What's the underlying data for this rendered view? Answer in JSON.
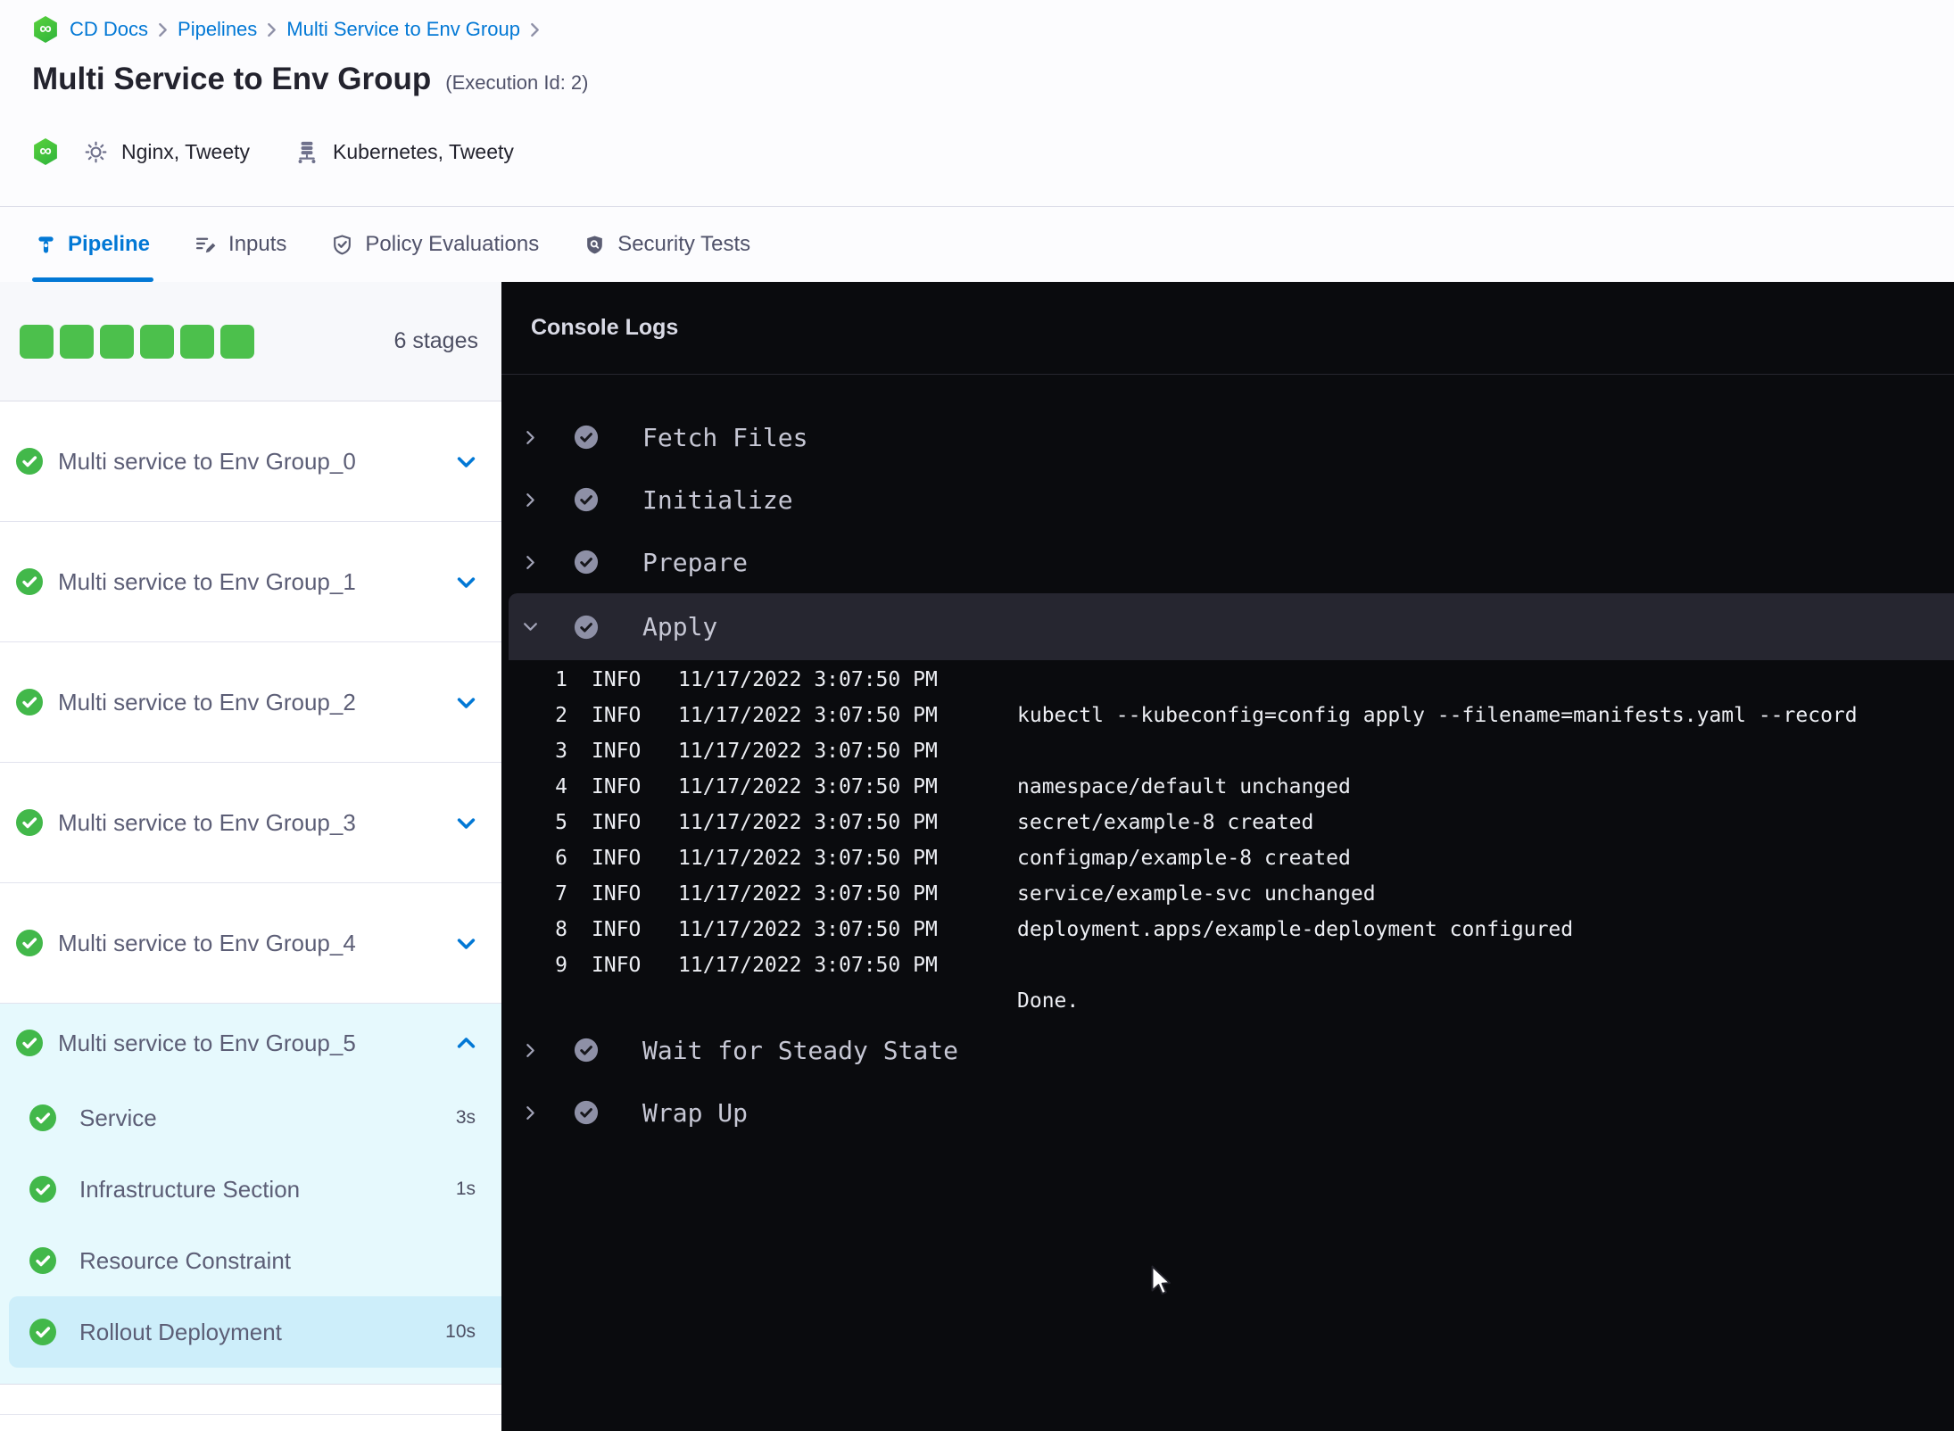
{
  "colors": {
    "accent_blue": "#0278d5",
    "success_green": "#42b84a",
    "progress_square_green": "#4cc04c",
    "console_bg": "#0a0b0e",
    "expanded_stage_bg": "#e6f9fd",
    "selected_step_bg": "#cdeefa"
  },
  "breadcrumb": {
    "items": [
      {
        "label": "CD Docs"
      },
      {
        "label": "Pipelines"
      },
      {
        "label": "Multi Service to Env Group"
      }
    ]
  },
  "header": {
    "title": "Multi Service to Env Group",
    "execution_id": "(Execution Id: 2)",
    "services_label": "Nginx, Tweety",
    "environments_label": "Kubernetes, Tweety"
  },
  "tabs": [
    {
      "label": "Pipeline"
    },
    {
      "label": "Inputs"
    },
    {
      "label": "Policy Evaluations"
    },
    {
      "label": "Security Tests"
    }
  ],
  "sidebar": {
    "progress_squares": 6,
    "stage_count_label": "6 stages",
    "stages": [
      {
        "label": "Multi service to Env Group_0"
      },
      {
        "label": "Multi service to Env Group_1"
      },
      {
        "label": "Multi service to Env Group_2"
      },
      {
        "label": "Multi service to Env Group_3"
      },
      {
        "label": "Multi service to Env Group_4"
      }
    ],
    "expanded_stage": {
      "label": "Multi service to Env Group_5",
      "steps": [
        {
          "label": "Service",
          "duration": "3s"
        },
        {
          "label": "Infrastructure Section",
          "duration": "1s"
        },
        {
          "label": "Resource Constraint",
          "duration": ""
        },
        {
          "label": "Rollout Deployment",
          "duration": "10s",
          "selected": true
        }
      ]
    }
  },
  "console": {
    "title": "Console Logs",
    "steps_top": [
      {
        "label": "Fetch Files"
      },
      {
        "label": "Initialize"
      },
      {
        "label": "Prepare"
      }
    ],
    "apply": {
      "label": "Apply",
      "logs": [
        {
          "num": "1",
          "level": "INFO",
          "time": "11/17/2022 3:07:50 PM",
          "message": ""
        },
        {
          "num": "2",
          "level": "INFO",
          "time": "11/17/2022 3:07:50 PM",
          "message": "kubectl --kubeconfig=config apply --filename=manifests.yaml --record"
        },
        {
          "num": "3",
          "level": "INFO",
          "time": "11/17/2022 3:07:50 PM",
          "message": ""
        },
        {
          "num": "4",
          "level": "INFO",
          "time": "11/17/2022 3:07:50 PM",
          "message": "namespace/default unchanged"
        },
        {
          "num": "5",
          "level": "INFO",
          "time": "11/17/2022 3:07:50 PM",
          "message": "secret/example-8 created"
        },
        {
          "num": "6",
          "level": "INFO",
          "time": "11/17/2022 3:07:50 PM",
          "message": "configmap/example-8 created"
        },
        {
          "num": "7",
          "level": "INFO",
          "time": "11/17/2022 3:07:50 PM",
          "message": "service/example-svc unchanged"
        },
        {
          "num": "8",
          "level": "INFO",
          "time": "11/17/2022 3:07:50 PM",
          "message": "deployment.apps/example-deployment configured"
        },
        {
          "num": "9",
          "level": "INFO",
          "time": "11/17/2022 3:07:50 PM",
          "message": ""
        },
        {
          "num": "",
          "level": "",
          "time": "",
          "message": "Done."
        }
      ]
    },
    "steps_bottom": [
      {
        "label": "Wait for Steady State"
      },
      {
        "label": "Wrap Up"
      }
    ]
  }
}
